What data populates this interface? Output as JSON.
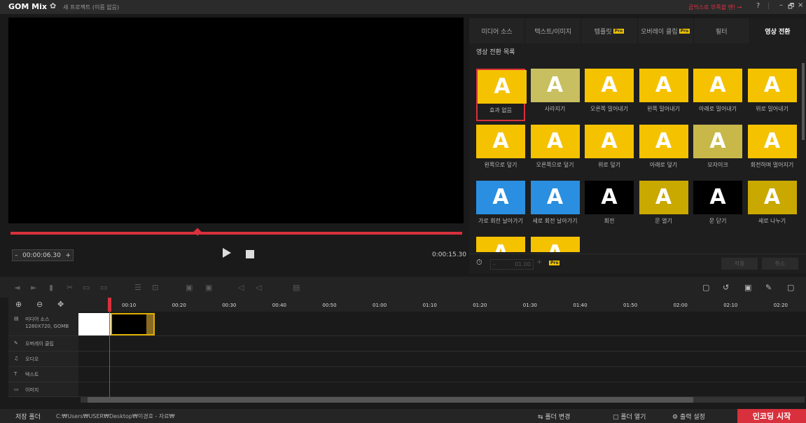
{
  "app": {
    "logo": "GOM Mix",
    "gear_icon": "gear-icon",
    "project_name": "새 프로젝트 (이름 없음)",
    "promo": "곰믹스로 부족할 땐! →",
    "help": "?",
    "sep": "|",
    "minimize": "–",
    "restore": "🗗",
    "close": "×"
  },
  "player": {
    "timecode": "00:00:06.30",
    "minus": "–",
    "plus": "+",
    "duration": "0:00:15.30",
    "progress_fraction": 0.41
  },
  "tabs": [
    {
      "label": "미디어 소스",
      "pro": ""
    },
    {
      "label": "텍스트/이미지",
      "pro": ""
    },
    {
      "label": "템플릿",
      "pro": "Pro"
    },
    {
      "label": "오버레이 클립",
      "pro": "Pro"
    },
    {
      "label": "필터",
      "pro": ""
    },
    {
      "label": "영상 전환",
      "pro": ""
    }
  ],
  "panel": {
    "title": "영상 전환 목록",
    "transitions": [
      "효과 없음",
      "사라지기",
      "오른쪽 밀어내기",
      "왼쪽 밀어내기",
      "아래로 밀어내기",
      "위로 밀어내기",
      "왼쪽으로 덮기",
      "오른쪽으로 덮기",
      "위로 덮기",
      "아래로 덮기",
      "모자이크",
      "회전하며 멀어지기",
      "가로 회전 날아가기",
      "세로 회전 날아가기",
      "회전",
      "문 열기",
      "문 닫기",
      "세로 나누기",
      "",
      ""
    ],
    "thumb_glyph": "A",
    "duration": "01.00",
    "minus": "–",
    "plus": "+",
    "pro": "Pro",
    "apply": "적용",
    "cancel": "취소"
  },
  "timeline": {
    "ticks": [
      "00:10",
      "00:20",
      "00:30",
      "00:40",
      "00:50",
      "01:00",
      "01:10",
      "01:20",
      "01:30",
      "01:40",
      "01:50",
      "02:00",
      "02:10",
      "02:20"
    ],
    "tracks": [
      {
        "name": "미디어 소스",
        "sub": "1280X720, GOMB"
      },
      {
        "name": "오버레이 클립",
        "sub": ""
      },
      {
        "name": "오디오",
        "sub": ""
      },
      {
        "name": "텍스트",
        "sub": ""
      },
      {
        "name": "이미지",
        "sub": ""
      }
    ]
  },
  "status": {
    "folder_label": "저장 폴더",
    "folder_path": "C:₩Users₩USER₩Desktop₩이경호 - 자료₩",
    "change_folder": "폴더 변경",
    "open_folder": "폴더 열기",
    "output_settings": "출력 설정",
    "encode": "인코딩 시작"
  },
  "colors": {
    "accent": "#d8303c",
    "pro_badge": "#f0c400",
    "thumb_bg": "#f5c200",
    "thumb_blue": "#2a8fe0"
  }
}
